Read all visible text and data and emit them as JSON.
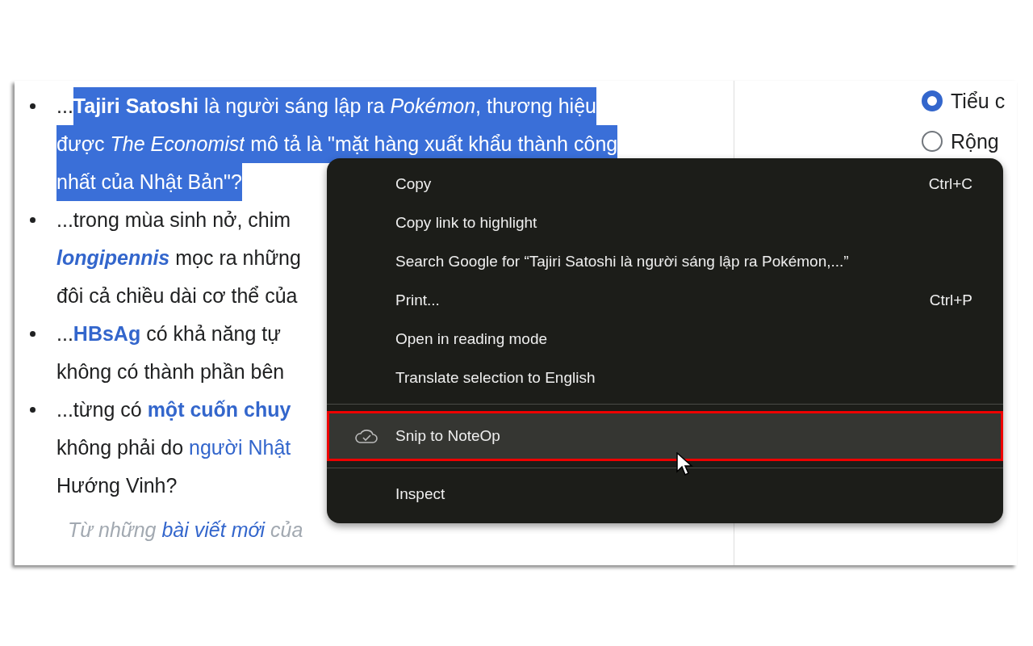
{
  "article": {
    "bullets": [
      {
        "lines": [
          [
            {
              "text": "...",
              "kind": "text",
              "selected": false
            },
            {
              "text": "Tajiri Satoshi",
              "kind": "bold",
              "selected": true
            },
            {
              "text": " là người sáng lập ra ",
              "kind": "text",
              "selected": true
            },
            {
              "text": "Pokémon",
              "kind": "italic",
              "selected": true
            },
            {
              "text": ", thương hiệu",
              "kind": "text",
              "selected": true
            }
          ],
          [
            {
              "text": "được ",
              "kind": "text",
              "selected": true
            },
            {
              "text": "The Economist",
              "kind": "italic",
              "selected": true
            },
            {
              "text": " mô tả là \"mặt hàng xuất khẩu thành công",
              "kind": "text",
              "selected": true
            }
          ],
          [
            {
              "text": "nhất của Nhật Bản\"?",
              "kind": "text",
              "selected": true
            }
          ]
        ]
      },
      {
        "lines": [
          [
            {
              "text": "...trong mùa sinh nở, chim",
              "kind": "text",
              "selected": false
            }
          ],
          [
            {
              "text": "longipennis",
              "kind": "link-bold-italic",
              "selected": false
            },
            {
              "text": " mọc ra những",
              "kind": "text",
              "selected": false
            }
          ],
          [
            {
              "text": "đôi cả chiều dài cơ thể của",
              "kind": "text",
              "selected": false
            }
          ]
        ]
      },
      {
        "lines": [
          [
            {
              "text": "...",
              "kind": "text",
              "selected": false
            },
            {
              "text": "HBsAg",
              "kind": "link-bold",
              "selected": false
            },
            {
              "text": " có khả năng tự",
              "kind": "text",
              "selected": false
            }
          ],
          [
            {
              "text": "không có thành phần bên",
              "kind": "text",
              "selected": false
            }
          ]
        ]
      },
      {
        "lines": [
          [
            {
              "text": "...từng có ",
              "kind": "text",
              "selected": false
            },
            {
              "text": "một cuốn chuy",
              "kind": "link-bold",
              "selected": false
            }
          ],
          [
            {
              "text": "không phải do ",
              "kind": "text",
              "selected": false
            },
            {
              "text": "người Nhật",
              "kind": "link",
              "selected": false
            }
          ],
          [
            {
              "text": "Hướng Vinh?",
              "kind": "text",
              "selected": false
            }
          ]
        ]
      }
    ],
    "footer": [
      {
        "text": "Từ những ",
        "kind": "muted-italic",
        "selected": false
      },
      {
        "text": "bài viết mới",
        "kind": "link-italic",
        "selected": false
      },
      {
        "text": " của",
        "kind": "muted-italic",
        "selected": false
      }
    ]
  },
  "sidebar": {
    "radios": [
      {
        "label": "Tiểu c",
        "selected": true
      },
      {
        "label": "Rộng",
        "selected": false
      }
    ]
  },
  "context_menu": {
    "groups": [
      [
        {
          "label": "Copy",
          "shortcut": "Ctrl+C",
          "selected": false,
          "outlined": false,
          "icon": false
        },
        {
          "label": "Copy link to highlight",
          "selected": false,
          "outlined": false,
          "icon": false
        },
        {
          "label": "Search Google for “Tajiri Satoshi là người sáng lập ra Pokémon,...”",
          "selected": false,
          "outlined": false,
          "icon": false
        },
        {
          "label": "Print...",
          "shortcut": "Ctrl+P",
          "selected": false,
          "outlined": false,
          "icon": false
        },
        {
          "label": "Open in reading mode",
          "selected": false,
          "outlined": false,
          "icon": false
        },
        {
          "label": "Translate selection to English",
          "selected": false,
          "outlined": false,
          "icon": false
        }
      ],
      [
        {
          "label": "Snip to NoteOp",
          "selected": true,
          "outlined": true,
          "icon": true
        }
      ],
      [
        {
          "label": "Inspect",
          "selected": false,
          "outlined": false,
          "icon": false
        }
      ]
    ]
  }
}
